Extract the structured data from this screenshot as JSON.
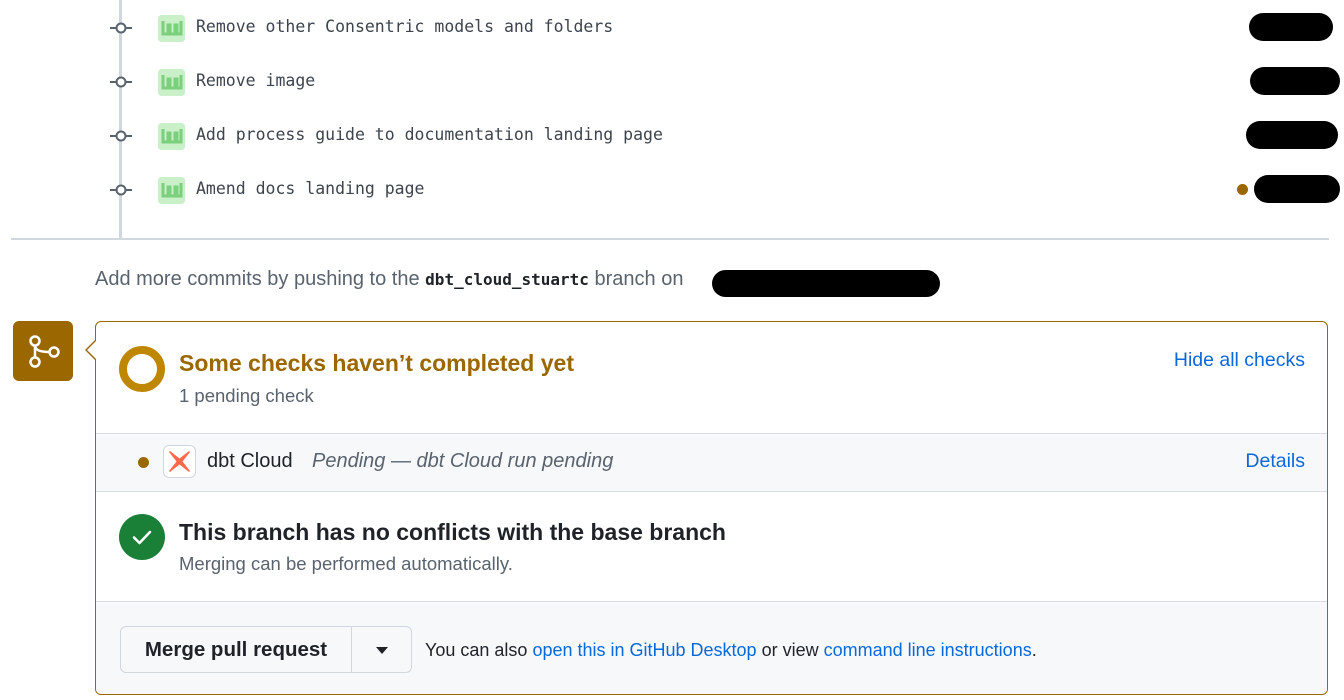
{
  "commits": [
    {
      "message": "Remove other Consentric models and folders"
    },
    {
      "message": "Remove image"
    },
    {
      "message": "Add process guide to documentation landing page"
    },
    {
      "message": "Amend docs landing page"
    }
  ],
  "push_hint": {
    "prefix": "Add more commits by pushing to the",
    "branch": "dbt_cloud_stuartc",
    "suffix": "branch on"
  },
  "checks": {
    "title": "Some checks haven’t completed yet",
    "subtitle": "1 pending check",
    "toggle_link": "Hide all checks",
    "items": [
      {
        "name": "dbt Cloud",
        "description": "Pending — dbt Cloud run pending",
        "link": "Details",
        "status": "pending"
      }
    ]
  },
  "conflicts": {
    "title": "This branch has no conflicts with the base branch",
    "subtitle": "Merging can be performed automatically."
  },
  "merge": {
    "button_label": "Merge pull request",
    "also_prefix": "You can also",
    "desktop_link": "open this in GitHub Desktop",
    "or_text": "or view",
    "cli_link": "command line instructions",
    "period": "."
  },
  "colors": {
    "pending": "#9a6700",
    "success": "#1a7f37",
    "link": "#0969da",
    "dbt_orange": "#ff694a"
  },
  "icons": {
    "commit": "git-commit-icon",
    "merge": "git-merge-icon",
    "pending": "pending-ring-icon",
    "success": "check-circle-icon",
    "dropdown": "triangle-down-icon"
  }
}
